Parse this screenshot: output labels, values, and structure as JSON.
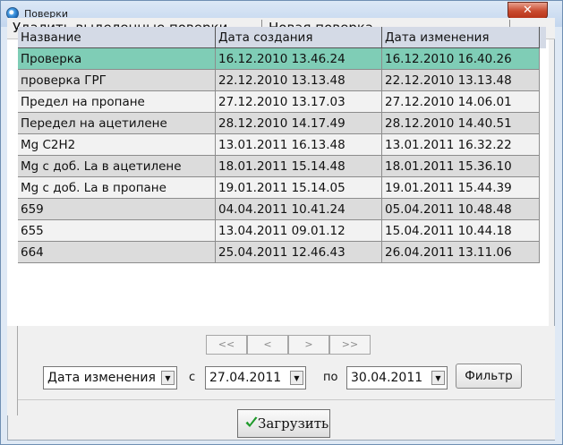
{
  "window": {
    "title": "Поверки",
    "close_glyph": "✕"
  },
  "menu": {
    "delete_label": "Удалить выделенные поверки",
    "new_label": "Новая поверка"
  },
  "table": {
    "columns": [
      "Название",
      "Дата создания",
      "Дата изменения"
    ],
    "rows": [
      [
        "Проверка",
        "16.12.2010 13.46.24",
        "16.12.2010 16.40.26"
      ],
      [
        "проверка ГРГ",
        "22.12.2010 13.13.48",
        "22.12.2010 13.13.48"
      ],
      [
        "Предел на пропане",
        "27.12.2010 13.17.03",
        "27.12.2010 14.06.01"
      ],
      [
        "Передел на ацетилене",
        "28.12.2010 14.17.49",
        "28.12.2010 14.40.51"
      ],
      [
        "Mg C2H2",
        "13.01.2011 16.13.48",
        "13.01.2011 16.32.22"
      ],
      [
        "Mg с доб. La в ацетилене",
        "18.01.2011 15.14.48",
        "18.01.2011 15.36.10"
      ],
      [
        "Mg с доб. La в пропане",
        "19.01.2011 15.14.05",
        "19.01.2011 15.44.39"
      ],
      [
        "659",
        "04.04.2011 10.41.24",
        "05.04.2011 10.48.48"
      ],
      [
        "655",
        "13.04.2011 09.01.12",
        "15.04.2011 10.44.18"
      ],
      [
        "664",
        "25.04.2011 12.46.43",
        "26.04.2011 13.11.06"
      ]
    ],
    "selected_row": 0
  },
  "pager": {
    "first": "<<",
    "prev": "<",
    "next": ">",
    "last": ">>"
  },
  "filter": {
    "field_value": "Дата изменения",
    "from_label": "с",
    "from_date": "27.04.2011",
    "to_label": "по",
    "to_date": "30.04.2011",
    "button_label": "Фильтр",
    "dropdown_glyph": "▼"
  },
  "load": {
    "label": "Загрузить",
    "icon": "check-icon",
    "icon_color": "#1e9a2a"
  },
  "colors": {
    "selected_row": "#7fcdb6",
    "header_bg": "#d4dae6"
  }
}
